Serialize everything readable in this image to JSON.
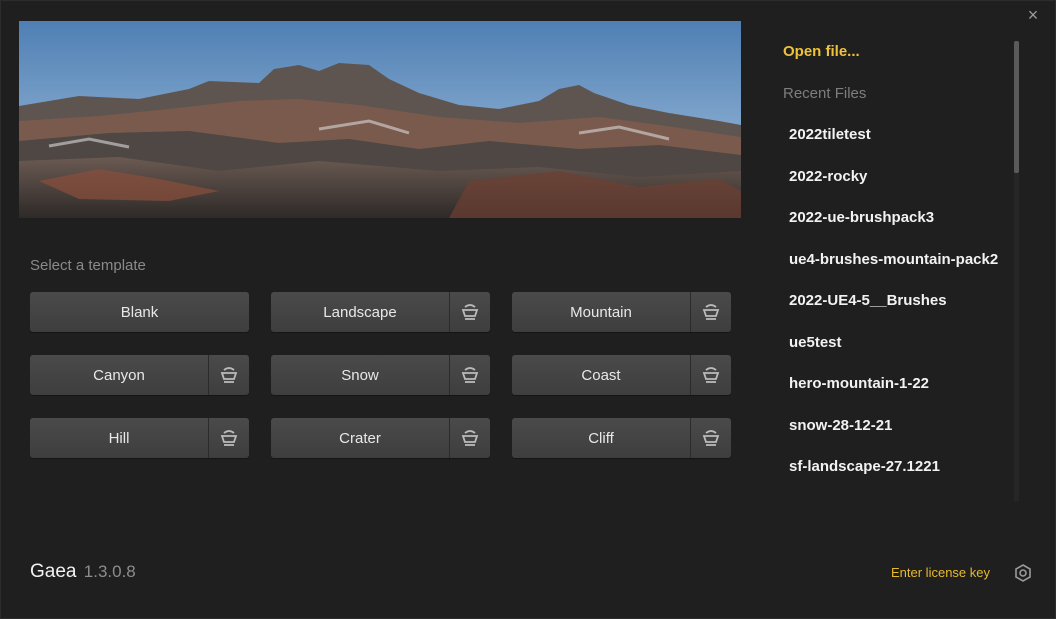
{
  "window": {
    "close_glyph": "×"
  },
  "hero": {
    "image": "desert-mountain-landscape"
  },
  "templates": {
    "heading": "Select a template",
    "items": [
      {
        "label": "Blank",
        "has_kit": false
      },
      {
        "label": "Landscape",
        "has_kit": true
      },
      {
        "label": "Mountain",
        "has_kit": true
      },
      {
        "label": "Canyon",
        "has_kit": true
      },
      {
        "label": "Snow",
        "has_kit": true
      },
      {
        "label": "Coast",
        "has_kit": true
      },
      {
        "label": "Hill",
        "has_kit": true
      },
      {
        "label": "Crater",
        "has_kit": true
      },
      {
        "label": "Cliff",
        "has_kit": true
      }
    ]
  },
  "sidebar": {
    "open_file": "Open file...",
    "recent_heading": "Recent Files",
    "recent_files": [
      "2022tiletest",
      "2022-rocky",
      "2022-ue-brushpack3",
      "ue4-brushes-mountain-pack2",
      "2022-UE4-5__Brushes",
      "ue5test",
      "hero-mountain-1-22",
      "snow-28-12-21",
      "sf-landscape-27.1221"
    ]
  },
  "footer": {
    "app_name": "Gaea",
    "version": "1.3.0.8",
    "license_link": "Enter license key",
    "settings_icon": "gear-icon"
  },
  "colors": {
    "background": "#1f1f1f",
    "accent": "#f0c23b",
    "button": "#444444",
    "muted_text": "#8a8a8a"
  }
}
